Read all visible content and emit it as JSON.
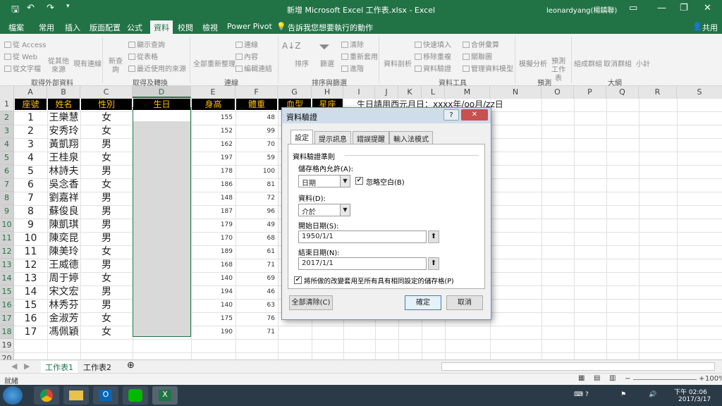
{
  "window": {
    "title": "新增 Microsoft Excel 工作表.xlsx - Excel",
    "user": "leonardyang(楊鎮聯)",
    "icons": [
      "save-icon",
      "undo-icon",
      "redo-icon",
      "customize-icon",
      "ribbon-display-icon",
      "minimize-icon",
      "restore-icon",
      "close-icon"
    ]
  },
  "ribbon": {
    "tabs": [
      "檔案",
      "常用",
      "插入",
      "版面配置",
      "公式",
      "資料",
      "校閱",
      "檢視",
      "Power Pivot"
    ],
    "active_tab": "資料",
    "tell_me": "告訴我您想要執行的動作",
    "share": "共用",
    "groups": [
      "取得外部資料",
      "取得及轉換",
      "連線",
      "排序與篩選",
      "資料工具",
      "預測",
      "大綱"
    ],
    "external": [
      "從 Access",
      "從 Web",
      "從文字檔",
      "從其他來源",
      "現有連線"
    ],
    "transform": [
      "新查詢",
      "顯示查詢",
      "從表格",
      "最近使用的來源"
    ],
    "connections": [
      "全部重新整理",
      "連線",
      "內容",
      "編輯連結"
    ],
    "sort": [
      "排序",
      "篩選",
      "清除",
      "重新套用",
      "進階"
    ],
    "tools": [
      "資料剖析",
      "快速填入",
      "移除重複",
      "資料驗證",
      "合併彙算",
      "關聯圖",
      "管理資料模型"
    ],
    "forecast": [
      "模擬分析",
      "預測工作表"
    ],
    "outline": [
      "組成群組",
      "取消群組",
      "小計"
    ]
  },
  "grid": {
    "columns": [
      "A",
      "B",
      "C",
      "D",
      "E",
      "F",
      "G",
      "H",
      "I",
      "J",
      "K",
      "L",
      "M",
      "N",
      "O",
      "P",
      "Q",
      "R",
      "S"
    ],
    "row_numbers": [
      "1",
      "2",
      "3",
      "4",
      "5",
      "6",
      "7",
      "8",
      "9",
      "10",
      "11",
      "12",
      "13",
      "14",
      "15",
      "16",
      "17",
      "18",
      "19",
      "20"
    ],
    "headers": [
      "座號",
      "姓名",
      "性別",
      "生日",
      "身高",
      "體重",
      "血型",
      "星座"
    ],
    "note": "生日請用西元月日：xxxx年/oo月/zz日",
    "rows": [
      {
        "no": "1",
        "name": "王樂慧",
        "sex": "女",
        "h": "155",
        "w": "48"
      },
      {
        "no": "2",
        "name": "安秀玲",
        "sex": "女",
        "h": "152",
        "w": "99"
      },
      {
        "no": "3",
        "name": "黃凱翔",
        "sex": "男",
        "h": "162",
        "w": "70"
      },
      {
        "no": "4",
        "name": "王桂泉",
        "sex": "女",
        "h": "197",
        "w": "59"
      },
      {
        "no": "5",
        "name": "林詩夫",
        "sex": "男",
        "h": "178",
        "w": "100"
      },
      {
        "no": "6",
        "name": "吳念香",
        "sex": "女",
        "h": "186",
        "w": "81"
      },
      {
        "no": "7",
        "name": "劉嘉祥",
        "sex": "男",
        "h": "148",
        "w": "72"
      },
      {
        "no": "8",
        "name": "蘇俊良",
        "sex": "男",
        "h": "187",
        "w": "96"
      },
      {
        "no": "9",
        "name": "陳凱琪",
        "sex": "男",
        "h": "179",
        "w": "49"
      },
      {
        "no": "10",
        "name": "陳奕昆",
        "sex": "男",
        "h": "170",
        "w": "68"
      },
      {
        "no": "11",
        "name": "陳美玲",
        "sex": "女",
        "h": "189",
        "w": "61"
      },
      {
        "no": "12",
        "name": "王威德",
        "sex": "男",
        "h": "168",
        "w": "71"
      },
      {
        "no": "13",
        "name": "周于婷",
        "sex": "女",
        "h": "140",
        "w": "69"
      },
      {
        "no": "14",
        "name": "宋文宏",
        "sex": "男",
        "h": "194",
        "w": "46"
      },
      {
        "no": "15",
        "name": "林秀芬",
        "sex": "男",
        "h": "140",
        "w": "63"
      },
      {
        "no": "16",
        "name": "金淑芳",
        "sex": "女",
        "h": "175",
        "w": "76"
      },
      {
        "no": "17",
        "name": "馮佩穎",
        "sex": "女",
        "h": "190",
        "w": "71"
      }
    ]
  },
  "sheets": [
    "工作表1",
    "工作表2"
  ],
  "active_sheet": "工作表1",
  "status": {
    "left": "就緒",
    "zoom": "100%"
  },
  "dialog": {
    "title": "資料驗證",
    "tabs": [
      "設定",
      "提示訊息",
      "錯誤提醒",
      "輸入法模式"
    ],
    "section": "資料驗證準則",
    "allow_label": "儲存格內允許(A):",
    "allow_value": "日期",
    "ignore_blank": "忽略空白(B)",
    "data_label": "資料(D):",
    "data_value": "介於",
    "start_label": "開始日期(S):",
    "start_value": "1950/1/1",
    "end_label": "結束日期(N):",
    "end_value": "2017/1/1",
    "apply_all": "將所做的改變套用至所有具有相同設定的儲存格(P)",
    "clear_all": "全部清除(C)",
    "ok": "確定",
    "cancel": "取消",
    "help": "?"
  },
  "clock": {
    "time": "下午 02:06",
    "date": "2017/3/17"
  }
}
